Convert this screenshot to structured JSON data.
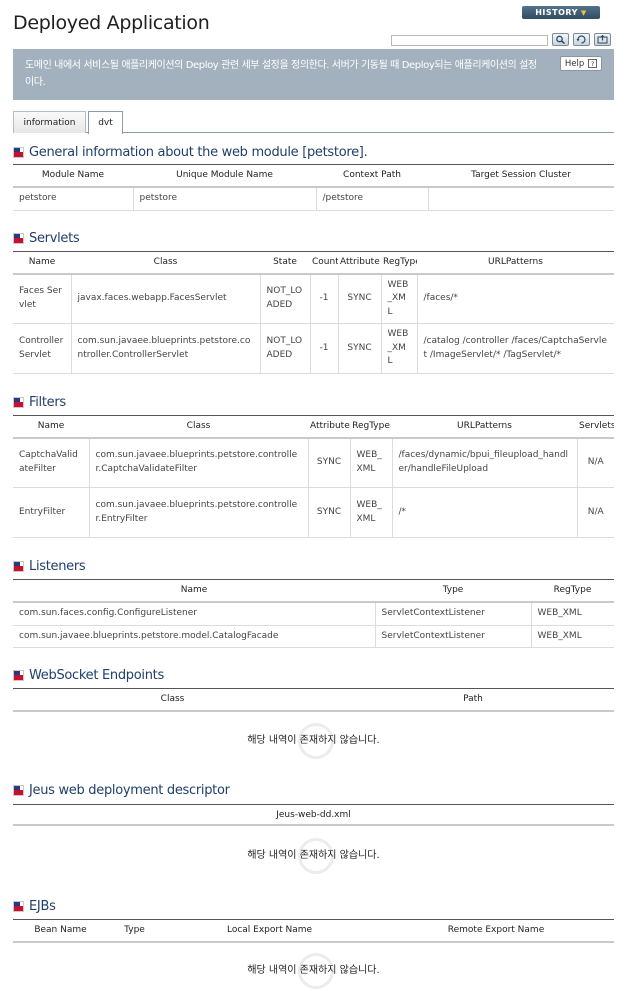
{
  "header": {
    "title": "Deployed Application",
    "history_label": "HISTORY",
    "search_value": "",
    "icons": [
      "search-icon",
      "refresh-icon",
      "export-icon"
    ]
  },
  "banner": {
    "text": "도메인 내에서 서비스될 애플리케이션의 Deploy 관련 세부 설정을 정의한다. 서버가 기동될 때 Deploy되는 애플리케이션의 설정이다.",
    "help_label": "Help",
    "help_icon": "?"
  },
  "tabs": [
    {
      "label": "information",
      "active": false
    },
    {
      "label": "dvt",
      "active": true
    }
  ],
  "colors": {
    "banner": "#a2b1bd",
    "title": "#1f3f6a",
    "flag_blue": "#213b86",
    "flag_red": "#c8102e"
  },
  "general": {
    "title": "General information about the web module [petstore].",
    "columns": [
      "Module Name",
      "Unique Module Name",
      "Context Path",
      "Target Session Cluster"
    ],
    "rows": [
      [
        "petstore",
        "petstore",
        "/petstore",
        ""
      ]
    ]
  },
  "servlets": {
    "title": "Servlets",
    "columns": [
      "Name",
      "Class",
      "State",
      "Count",
      "Attribute",
      "RegType",
      "URLPatterns"
    ],
    "rows": [
      [
        "Faces Servlet",
        "javax.faces.webapp.FacesServlet",
        "NOT_LOADED",
        "-1",
        "SYNC",
        "WEB_XML",
        "/faces/*"
      ],
      [
        "ControllerServlet",
        "com.sun.javaee.blueprints.petstore.controller.ControllerServlet",
        "NOT_LOADED",
        "-1",
        "SYNC",
        "WEB_XML",
        "/catalog /controller /faces/CaptchaServlet /ImageServlet/* /TagServlet/*"
      ]
    ]
  },
  "filters": {
    "title": "Filters",
    "columns": [
      "Name",
      "Class",
      "Attribute",
      "RegType",
      "URLPatterns",
      "Servlets"
    ],
    "rows": [
      [
        "CaptchaValidateFilter",
        "com.sun.javaee.blueprints.petstore.controller.CaptchaValidateFilter",
        "SYNC",
        "WEB_XML",
        "/faces/dynamic/bpui_fileupload_handler/handleFileUpload",
        "N/A"
      ],
      [
        "EntryFilter",
        "com.sun.javaee.blueprints.petstore.controller.EntryFilter",
        "SYNC",
        "WEB_XML",
        "/*",
        "N/A"
      ]
    ]
  },
  "listeners": {
    "title": "Listeners",
    "columns": [
      "Name",
      "Type",
      "RegType"
    ],
    "rows": [
      [
        "com.sun.faces.config.ConfigureListener",
        "ServletContextListener",
        "WEB_XML"
      ],
      [
        "com.sun.javaee.blueprints.petstore.model.CatalogFacade",
        "ServletContextListener",
        "WEB_XML"
      ]
    ]
  },
  "websocket": {
    "title": "WebSocket Endpoints",
    "columns": [
      "Class",
      "Path"
    ],
    "empty": "해당 내역이 존재하지 않습니다."
  },
  "jeus_dd": {
    "title": "Jeus web deployment descriptor",
    "header": "Jeus-web-dd.xml",
    "empty": "해당 내역이 존재하지 않습니다."
  },
  "ejbs": {
    "title": "EJBs",
    "columns": [
      "Bean Name",
      "Type",
      "Local Export Name",
      "Remote Export Name"
    ],
    "empty": "해당 내역이 존재하지 않습니다."
  }
}
